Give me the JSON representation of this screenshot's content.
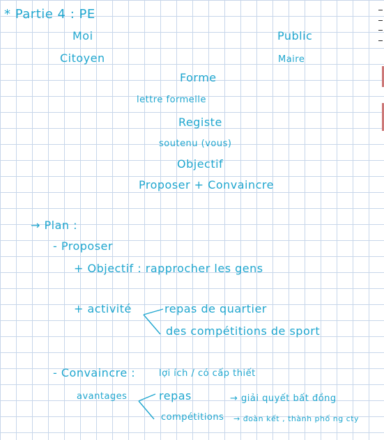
{
  "title": "* Partie 4 : PE",
  "header": {
    "left_role": "Moi",
    "left_identity": "Citoyen",
    "right_role": "Public",
    "right_identity": "Maire"
  },
  "forme": {
    "heading": "Forme",
    "type": "lettre formelle",
    "registre_heading": "Registe",
    "registre_value": "soutenu (vous)",
    "objectif_heading": "Objectif",
    "objectif_value": "Proposer + Convaincre"
  },
  "plan": {
    "heading": "→ Plan :",
    "proposer_heading": "- Proposer",
    "objectif_line": "+ Objectif : rapprocher les gens",
    "activite_label": "+ activité",
    "activite_items": [
      "repas de quartier",
      "des compétitions de sport"
    ],
    "convaincre_heading": "- Convaincre :",
    "convaincre_note": "lợi ích / có cấp thiết",
    "avantages_label": "avantages",
    "avantages_items": [
      "repas",
      "compétitions"
    ],
    "avantages_notes": [
      "→ giải quyết bất đồng",
      "→ đoàn kết , thành phố ng cty"
    ]
  },
  "colors": {
    "ink": "#1fa6cf",
    "grid": "#c7d6ea",
    "paper": "#ffffff"
  }
}
